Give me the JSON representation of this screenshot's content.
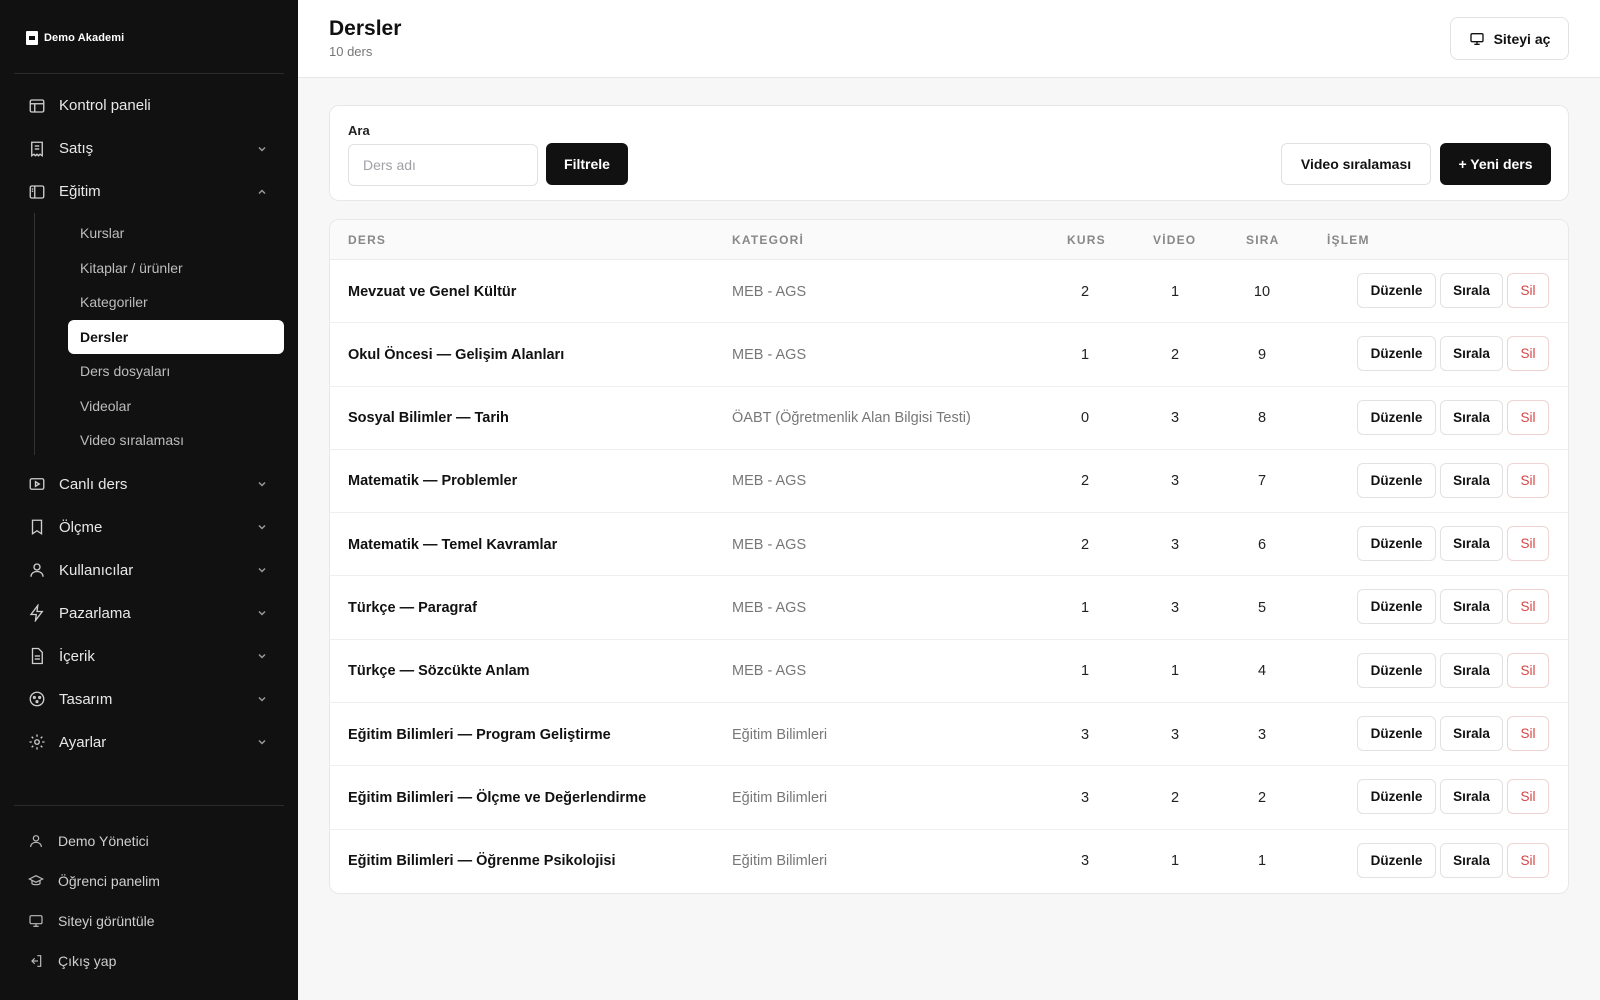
{
  "brand": {
    "name": "Demo Akademi"
  },
  "sidebar": {
    "items": [
      {
        "label": "Kontrol paneli",
        "icon": "dashboard-icon"
      },
      {
        "label": "Satış",
        "icon": "receipt-icon"
      },
      {
        "label": "Eğitim",
        "icon": "book-open-icon"
      },
      {
        "label": "Canlı ders",
        "icon": "video-play-icon"
      },
      {
        "label": "Ölçme",
        "icon": "bookmark-icon"
      },
      {
        "label": "Kullanıcılar",
        "icon": "user-icon"
      },
      {
        "label": "Pazarlama",
        "icon": "bolt-icon"
      },
      {
        "label": "İçerik",
        "icon": "file-icon"
      },
      {
        "label": "Tasarım",
        "icon": "palette-icon"
      },
      {
        "label": "Ayarlar",
        "icon": "gear-icon"
      }
    ],
    "egitim_sub": [
      {
        "label": "Kurslar"
      },
      {
        "label": "Kitaplar / ürünler"
      },
      {
        "label": "Kategoriler"
      },
      {
        "label": "Dersler"
      },
      {
        "label": "Ders dosyaları"
      },
      {
        "label": "Videolar"
      },
      {
        "label": "Video sıralaması"
      }
    ],
    "bottom": [
      {
        "label": "Demo Yönetici"
      },
      {
        "label": "Öğrenci panelim"
      },
      {
        "label": "Siteyi görüntüle"
      },
      {
        "label": "Çıkış yap"
      }
    ]
  },
  "header": {
    "title": "Dersler",
    "subtitle": "10 ders",
    "open_site_label": "Siteyi aç"
  },
  "filter": {
    "label": "Ara",
    "placeholder": "Ders adı",
    "value": "",
    "filter_button": "Filtrele",
    "video_order_button": "Video sıralaması",
    "new_button": "+ Yeni ders"
  },
  "table": {
    "columns": [
      "DERS",
      "KATEGORİ",
      "KURS",
      "VİDEO",
      "SIRA",
      "İŞLEM"
    ],
    "action_labels": {
      "edit": "Düzenle",
      "order": "Sırala",
      "delete": "Sil"
    },
    "rows": [
      {
        "name": "Mevzuat ve Genel Kültür",
        "category": "MEB - AGS",
        "kurs": "2",
        "video": "1",
        "sira": "10"
      },
      {
        "name": "Okul Öncesi — Gelişim Alanları",
        "category": "MEB - AGS",
        "kurs": "1",
        "video": "2",
        "sira": "9"
      },
      {
        "name": "Sosyal Bilimler — Tarih",
        "category": "ÖABT (Öğretmenlik Alan Bilgisi Testi)",
        "kurs": "0",
        "video": "3",
        "sira": "8"
      },
      {
        "name": "Matematik — Problemler",
        "category": "MEB - AGS",
        "kurs": "2",
        "video": "3",
        "sira": "7"
      },
      {
        "name": "Matematik — Temel Kavramlar",
        "category": "MEB - AGS",
        "kurs": "2",
        "video": "3",
        "sira": "6"
      },
      {
        "name": "Türkçe — Paragraf",
        "category": "MEB - AGS",
        "kurs": "1",
        "video": "3",
        "sira": "5"
      },
      {
        "name": "Türkçe — Sözcükte Anlam",
        "category": "MEB - AGS",
        "kurs": "1",
        "video": "1",
        "sira": "4"
      },
      {
        "name": "Eğitim Bilimleri — Program Geliştirme",
        "category": "Eğitim Bilimleri",
        "kurs": "3",
        "video": "3",
        "sira": "3"
      },
      {
        "name": "Eğitim Bilimleri — Ölçme ve Değerlendirme",
        "category": "Eğitim Bilimleri",
        "kurs": "3",
        "video": "2",
        "sira": "2"
      },
      {
        "name": "Eğitim Bilimleri — Öğrenme Psikolojisi",
        "category": "Eğitim Bilimleri",
        "kurs": "3",
        "video": "1",
        "sira": "1"
      }
    ]
  },
  "colors": {
    "sidebar_bg": "#111111",
    "accent_dark": "#111111",
    "danger": "#d64545"
  }
}
